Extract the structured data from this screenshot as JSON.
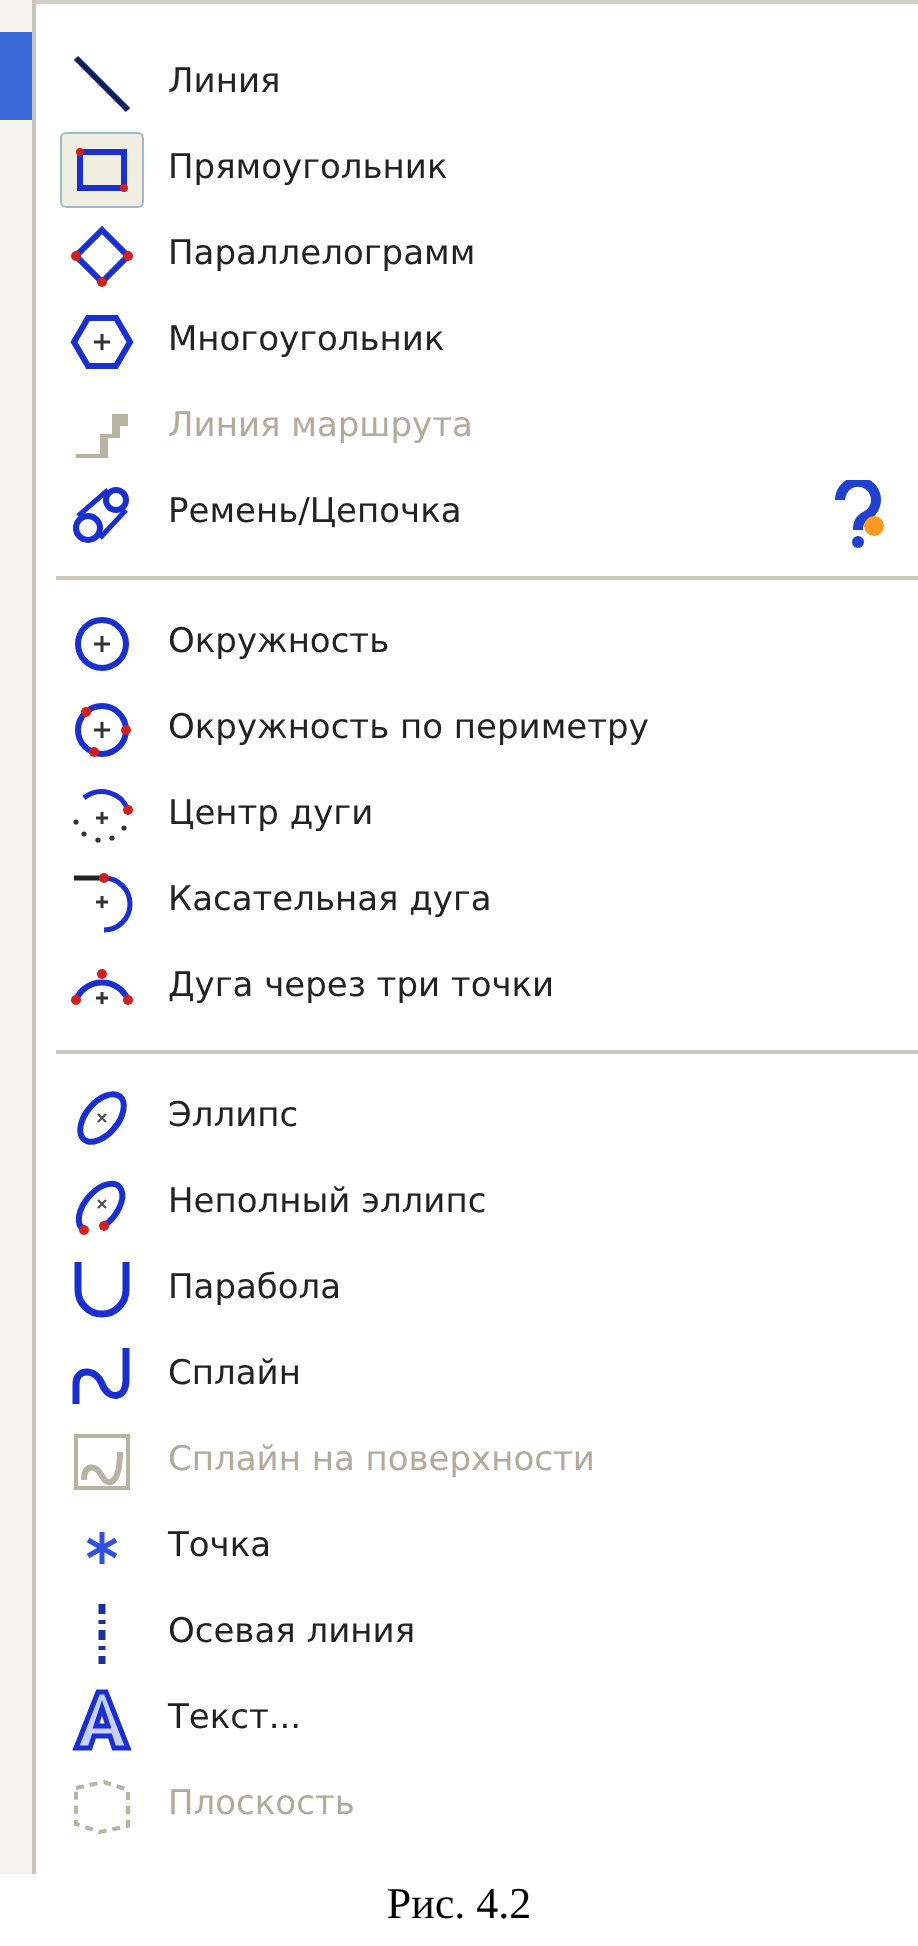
{
  "menu": {
    "groups": [
      {
        "items": [
          {
            "label": "Линия",
            "disabled": false,
            "checked": false,
            "help": false
          },
          {
            "label": "Прямоугольник",
            "disabled": false,
            "checked": true,
            "help": false
          },
          {
            "label": "Параллелограмм",
            "disabled": false,
            "checked": false,
            "help": false
          },
          {
            "label": "Многоугольник",
            "disabled": false,
            "checked": false,
            "help": false
          },
          {
            "label": "Линия маршрута",
            "disabled": true,
            "checked": false,
            "help": false
          },
          {
            "label": "Ремень/Цепочка",
            "disabled": false,
            "checked": false,
            "help": true
          }
        ]
      },
      {
        "items": [
          {
            "label": "Окружность",
            "disabled": false,
            "checked": false,
            "help": false
          },
          {
            "label": "Окружность по периметру",
            "disabled": false,
            "checked": false,
            "help": false
          },
          {
            "label": "Центр дуги",
            "disabled": false,
            "checked": false,
            "help": false
          },
          {
            "label": "Касательная дуга",
            "disabled": false,
            "checked": false,
            "help": false
          },
          {
            "label": "Дуга через три точки",
            "disabled": false,
            "checked": false,
            "help": false
          }
        ]
      },
      {
        "items": [
          {
            "label": "Эллипс",
            "disabled": false,
            "checked": false,
            "help": false
          },
          {
            "label": "Неполный эллипс",
            "disabled": false,
            "checked": false,
            "help": false
          },
          {
            "label": "Парабола",
            "disabled": false,
            "checked": false,
            "help": false
          },
          {
            "label": "Сплайн",
            "disabled": false,
            "checked": false,
            "help": false
          },
          {
            "label": "Сплайн на поверхности",
            "disabled": true,
            "checked": false,
            "help": false
          },
          {
            "label": "Точка",
            "disabled": false,
            "checked": false,
            "help": false
          },
          {
            "label": "Осевая линия",
            "disabled": false,
            "checked": false,
            "help": false
          },
          {
            "label": "Текст...",
            "disabled": false,
            "checked": false,
            "help": false
          },
          {
            "label": "Плоскость",
            "disabled": true,
            "checked": false,
            "help": false
          }
        ]
      }
    ]
  },
  "caption": "Рис. 4.2"
}
